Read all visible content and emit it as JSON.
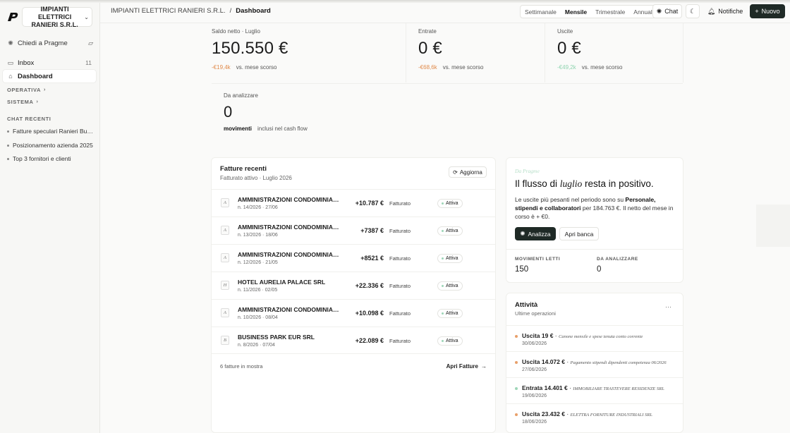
{
  "sidebar": {
    "org_name": "IMPIANTI ELETTRICI RANIERI S.R.L.",
    "ask_label": "Chiedi a Pragme",
    "nav": [
      {
        "label": "Inbox",
        "count": "11"
      },
      {
        "label": "Dashboard",
        "count": ""
      }
    ],
    "sections": [
      "OPERATIVA",
      "SISTEMA"
    ],
    "chat_header": "CHAT RECENTI",
    "chats": [
      "Fatture speculari Ranieri Business",
      "Posizionamento azienda 2025",
      "Top 3 fornitori e clienti"
    ]
  },
  "header": {
    "company": "IMPIANTI ELETTRICI RANIERI S.R.L.",
    "separator": "/",
    "page": "Dashboard",
    "periods": [
      "Settimanale",
      "Mensile",
      "Trimestrale",
      "Annuale"
    ],
    "selected_period": "Mensile",
    "chat_label": "Chat",
    "notify_label": "Notifiche",
    "new_label": "Nuovo"
  },
  "kpis": {
    "saldo": {
      "label": "Saldo netto · Luglio",
      "value": "150.550 €",
      "delta": "-€19,4k",
      "delta_text": "vs. mese scorso"
    },
    "entrate": {
      "label": "Entrate",
      "value": "0 €",
      "delta": "-€68,6k",
      "delta_text": "vs. mese scorso"
    },
    "uscite": {
      "label": "Uscite",
      "value": "0 €",
      "delta": "-€49,2k",
      "delta_text": "vs. mese scorso"
    },
    "analizzare": {
      "label": "Da analizzare",
      "value": "0",
      "unit": "movimenti",
      "note": "inclusi nel cash flow"
    }
  },
  "invoices": {
    "title": "Fatture recenti",
    "subtitle": "Fatturato attivo · Luglio 2026",
    "refresh_label": "Aggiorna",
    "rows": [
      {
        "initial": "A",
        "name": "AMMINISTRAZIONI CONDOMINIALI SRL",
        "meta": "n. 14/2026 · 27/06",
        "amount": "+10.787 €",
        "status": "Fatturato",
        "badge": "Attiva"
      },
      {
        "initial": "A",
        "name": "AMMINISTRAZIONI CONDOMINIALI SRL",
        "meta": "n. 13/2026 · 18/06",
        "amount": "+7387 €",
        "status": "Fatturato",
        "badge": "Attiva"
      },
      {
        "initial": "A",
        "name": "AMMINISTRAZIONI CONDOMINIALI SRL",
        "meta": "n. 12/2026 · 21/05",
        "amount": "+8521 €",
        "status": "Fatturato",
        "badge": "Attiva"
      },
      {
        "initial": "H",
        "name": "HOTEL AURELIA PALACE SRL",
        "meta": "n. 11/2026 · 02/05",
        "amount": "+22.336 €",
        "status": "Fatturato",
        "badge": "Attiva"
      },
      {
        "initial": "A",
        "name": "AMMINISTRAZIONI CONDOMINIALI SRL",
        "meta": "n. 10/2026 · 08/04",
        "amount": "+10.098 €",
        "status": "Fatturato",
        "badge": "Attiva"
      },
      {
        "initial": "B",
        "name": "BUSINESS PARK EUR SRL",
        "meta": "n. 8/2026 · 07/04",
        "amount": "+22.089 €",
        "status": "Fatturato",
        "badge": "Attiva"
      }
    ],
    "footer_count": "6 fatture in mostra",
    "open_label": "Apri Fatture"
  },
  "insight": {
    "tag": "Da Pragme",
    "head_a": "Il flusso di ",
    "head_it": "luglio",
    "head_b": " resta in positivo.",
    "body_a": "Le uscite più pesanti nel periodo sono su ",
    "body_bold": "Personale, stipendi e collaboratori",
    "body_b": " per 184.763 €. Il netto del mese in corso è + €0.",
    "btn_primary": "Analizza",
    "btn_secondary": "Apri banca",
    "stats": [
      {
        "label": "MOVIMENTI LETTI",
        "value": "150"
      },
      {
        "label": "DA ANALIZZARE",
        "value": "0"
      }
    ]
  },
  "activity": {
    "title": "Attività",
    "subtitle": "Ultime operazioni",
    "more": "···",
    "rows": [
      {
        "kind": "Uscita 19 €",
        "desc": "Canone mensile e spese tenuta conto corrente",
        "date": "30/06/2026",
        "color": "#e8a06a"
      },
      {
        "kind": "Uscita 14.072 €",
        "desc": "Pagamento stipendi dipendenti competenza 06/2026",
        "date": "27/06/2026",
        "color": "#e8a06a"
      },
      {
        "kind": "Entrata 14.401 €",
        "desc": "IMMOBILIARE TRASTEVERE RESIDENZE SRL",
        "date": "19/06/2026",
        "color": "#9dd6b8"
      },
      {
        "kind": "Uscita 23.432 €",
        "desc": "ELETTRA FORNITURE INDUSTRIALI SRL",
        "date": "18/06/2026",
        "color": "#e8a06a"
      }
    ]
  }
}
